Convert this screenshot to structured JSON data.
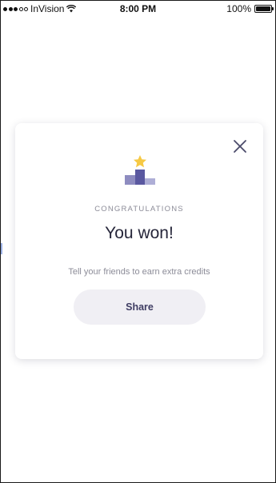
{
  "status_bar": {
    "carrier": "InVision",
    "time": "8:00 PM",
    "battery_percent": "100%"
  },
  "dialog": {
    "eyebrow": "CONGRATULATIONS",
    "title": "You won!",
    "message": "Tell your friends to earn extra credits",
    "share_label": "Share",
    "close_icon": "close-icon",
    "illustration_icon": "podium-star-icon"
  },
  "colors": {
    "accent": "#5a58a0",
    "accent_light": "#9fa0cc",
    "star": "#f6c944",
    "title": "#26263a",
    "muted": "#8c8c98",
    "button_bg": "#f0eff4"
  }
}
